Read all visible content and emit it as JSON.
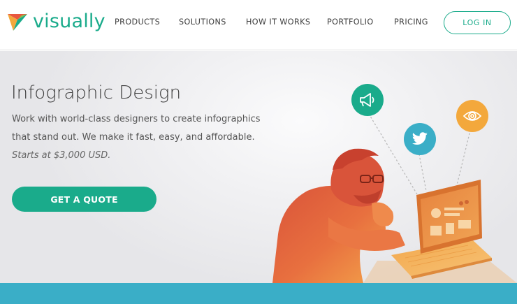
{
  "brand": {
    "name": "visually"
  },
  "nav": {
    "items": [
      {
        "label": "PRODUCTS"
      },
      {
        "label": "SOLUTIONS"
      },
      {
        "label": "HOW IT WORKS"
      },
      {
        "label": "PORTFOLIO"
      },
      {
        "label": "PRICING"
      }
    ],
    "login_label": "LOG IN"
  },
  "hero": {
    "title": "Infographic Design",
    "line1": "Work with world-class designers to create infographics",
    "line2": "that stand out. We make it fast, easy, and affordable.",
    "price": "Starts at $3,000 USD.",
    "cta_label": "GET A QUOTE",
    "icons": [
      {
        "name": "megaphone-icon",
        "color": "#1aab8b"
      },
      {
        "name": "twitter-icon",
        "color": "#3aaec7"
      },
      {
        "name": "eye-icon",
        "color": "#f3a83c"
      }
    ]
  },
  "colors": {
    "accent": "#1aab8b",
    "band": "#3aaec7",
    "orange": "#f3a83c"
  }
}
